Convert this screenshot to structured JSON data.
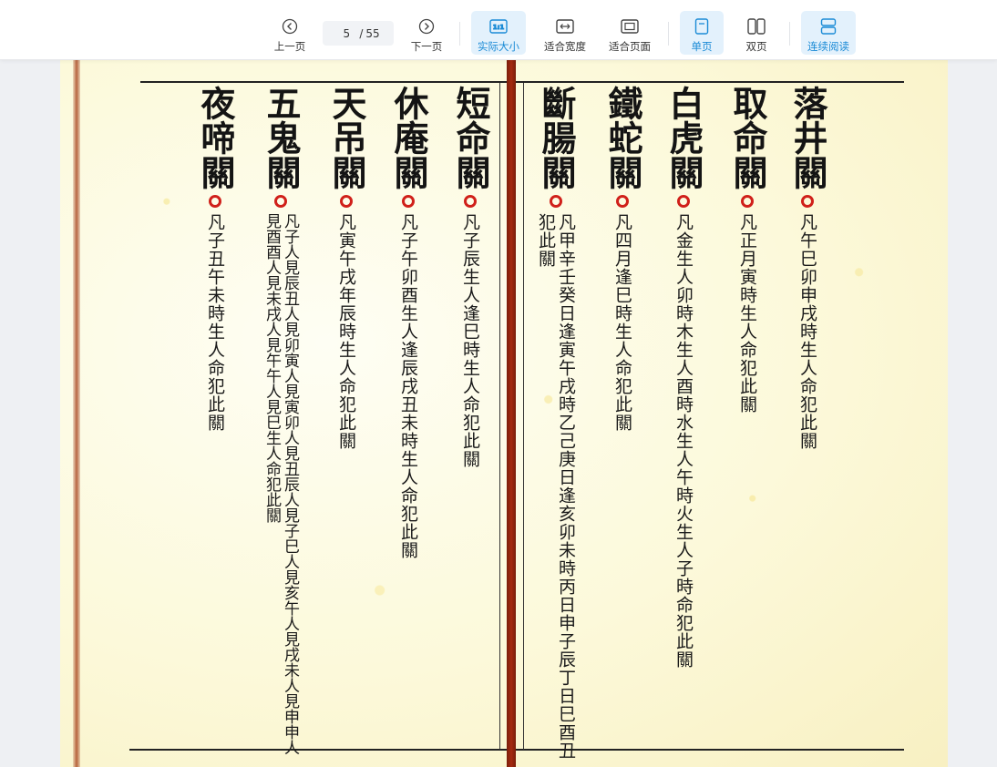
{
  "toolbar": {
    "prev_label": "上一页",
    "next_label": "下一页",
    "current_page": "5",
    "page_separator": "/",
    "total_pages": "55",
    "actual_size_label": "实际大小",
    "actual_size_icon_text": "1:1",
    "fit_width_label": "适合宽度",
    "fit_page_label": "适合页面",
    "single_page_label": "单页",
    "double_page_label": "双页",
    "continuous_label": "连续阅读"
  },
  "document": {
    "sections": [
      {
        "title": "落井關",
        "text": "凡午巳卯申戌時生人命犯此關"
      },
      {
        "title": "取命關",
        "text": "凡正月寅時生人命犯此關"
      },
      {
        "title": "白虎關",
        "text": "凡金生人卯時木生人酉時水生人午時火生人子時命犯此關"
      },
      {
        "title": "鐵蛇關",
        "text": "凡四月逢巳時生人命犯此關"
      },
      {
        "title": "斷腸關",
        "text": "凡甲辛壬癸日逢寅午戌時乙己庚日逢亥卯未時丙日申子辰丁日巳酉丑犯此關"
      },
      {
        "title": "短命關",
        "text": "凡子辰生人逢巳時生人命犯此關"
      },
      {
        "title": "休庵關",
        "text": "凡子午卯酉生人逢辰戌丑未時生人命犯此關"
      },
      {
        "title": "天吊關",
        "text": "凡寅午戌年辰時生人命犯此關"
      },
      {
        "title": "五鬼關",
        "text": "凡子人見辰丑人見卯寅人見寅卯人見丑辰人見子巳人見亥午人見戌未人見申申人見酉酉人見未戌人見午午人見巳生人命犯此關"
      },
      {
        "title": "夜啼關",
        "text": "凡子丑午未時生人命犯此關"
      }
    ]
  }
}
